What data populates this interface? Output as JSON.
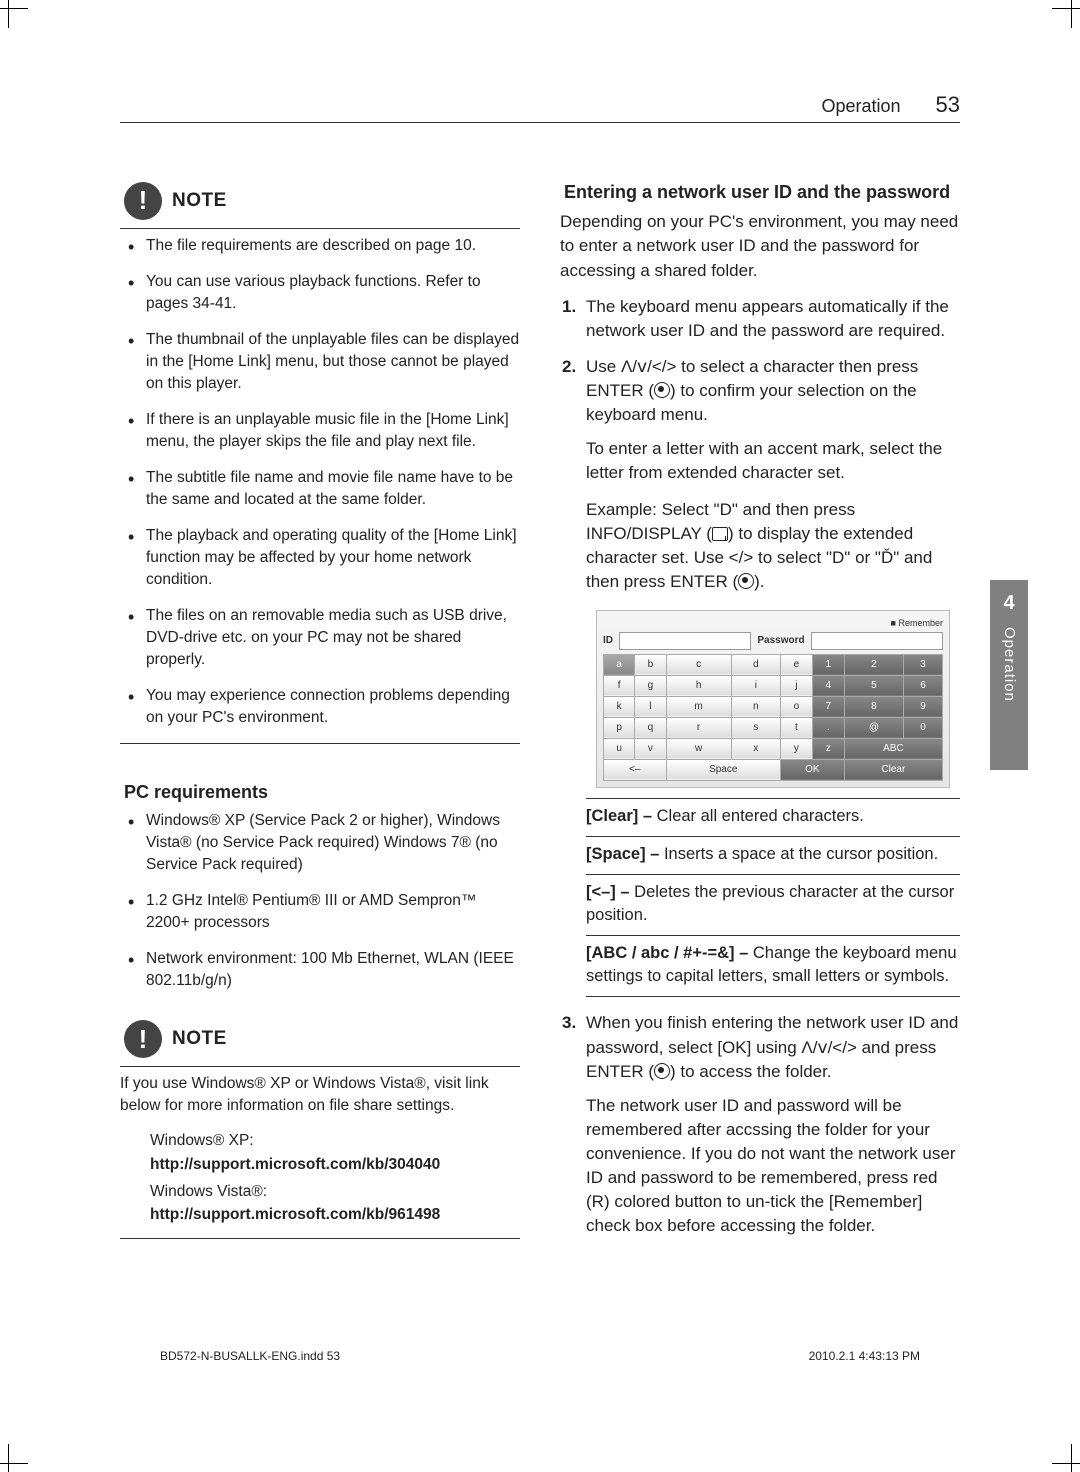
{
  "header": {
    "section": "Operation",
    "page_number": "53"
  },
  "side_tab": {
    "number": "4",
    "label": "Operation"
  },
  "note1": {
    "label": "NOTE",
    "items": [
      "The file requirements are described on page 10.",
      "You can use various playback functions. Refer to pages 34-41.",
      "The thumbnail of the unplayable files can be displayed in the [Home Link] menu, but those cannot be played on this player.",
      "If there is an unplayable music file in the [Home Link] menu, the player skips the file and play next file.",
      "The subtitle file name and movie file name have to be the same and located at the same folder.",
      "The playback and operating quality of the [Home Link] function may be affected by your home network condition.",
      "The files on an removable media such as USB drive, DVD-drive etc. on your PC may not be shared properly.",
      "You may experience connection problems depending on your PC's environment."
    ]
  },
  "pc_req": {
    "heading": "PC requirements",
    "items": [
      "Windows® XP (Service Pack 2 or higher), Windows Vista® (no Service Pack required) Windows 7® (no Service Pack required)",
      "1.2 GHz Intel® Pentium® III or AMD Sempron™ 2200+ processors",
      "Network environment: 100 Mb Ethernet, WLAN (IEEE 802.11b/g/n)"
    ]
  },
  "note2": {
    "label": "NOTE",
    "intro": "If you use Windows® XP or Windows Vista®, visit link below for more information on file share settings.",
    "xp_label": "Windows® XP:",
    "xp_url": "http://support.microsoft.com/kb/304040",
    "vista_label": "Windows Vista®:",
    "vista_url": "http://support.microsoft.com/kb/961498"
  },
  "right": {
    "heading": "Entering a network user ID and the password",
    "intro": "Depending on your PC's environment, you may need to enter a network user ID and the password for accessing a shared folder.",
    "step1": "The keyboard menu appears automatically if the network user ID and the password are required.",
    "step2a": "Use Λ/ⅴ/</> to select a character then press ENTER (",
    "step2b": ") to confirm your selection on the keyboard menu.",
    "step2_sub1": "To enter a letter with an accent mark, select the letter from extended character set.",
    "step2_sub2a": "Example: Select \"D\" and then press INFO/DISPLAY (",
    "step2_sub2b": ") to display the extended character set. Use </> to select \"D\" or \"Ď\" and then press ENTER (",
    "step2_sub2c": ").",
    "defs": {
      "clear": {
        "label": "[Clear] – ",
        "text": "Clear all entered characters."
      },
      "space": {
        "label": "[Space] – ",
        "text": "Inserts a space at the cursor position."
      },
      "back": {
        "label": "[<–] – ",
        "text": "Deletes the previous character at the cursor position."
      },
      "abc": {
        "label": "[ABC / abc / #+-=&] – ",
        "text": "Change the keyboard menu settings to capital letters, small letters or symbols."
      }
    },
    "step3a": "When you finish entering the network user ID and password, select [OK] using Λ/ⅴ/</> and press ENTER (",
    "step3b": ") to access the folder.",
    "step3_sub": "The network user ID and password will be remembered after accssing the folder for your convenience. If you do not want the network user ID and password to be remembered, press red (R) colored button to un-tick the [Remember] check box before accessing the folder."
  },
  "keyboard_ui": {
    "remember": "Remember",
    "id_label": "ID",
    "pw_label": "Password",
    "rows_letters": [
      [
        "a",
        "b",
        "c",
        "d",
        "e"
      ],
      [
        "f",
        "g",
        "h",
        "i",
        "j"
      ],
      [
        "k",
        "l",
        "m",
        "n",
        "o"
      ],
      [
        "p",
        "q",
        "r",
        "s",
        "t"
      ],
      [
        "u",
        "v",
        "w",
        "x",
        "y"
      ]
    ],
    "rows_dark": [
      [
        "1",
        "2",
        "3"
      ],
      [
        "4",
        "5",
        "6"
      ],
      [
        "7",
        "8",
        "9"
      ],
      [
        ".",
        "@",
        "0"
      ],
      [
        "z",
        "ABC",
        ""
      ]
    ],
    "bottom": [
      "<–",
      "Space",
      "OK",
      "Clear"
    ]
  },
  "footer": {
    "left": "BD572-N-BUSALLK-ENG.indd   53",
    "right": "2010.2.1   4:43:13 PM"
  }
}
